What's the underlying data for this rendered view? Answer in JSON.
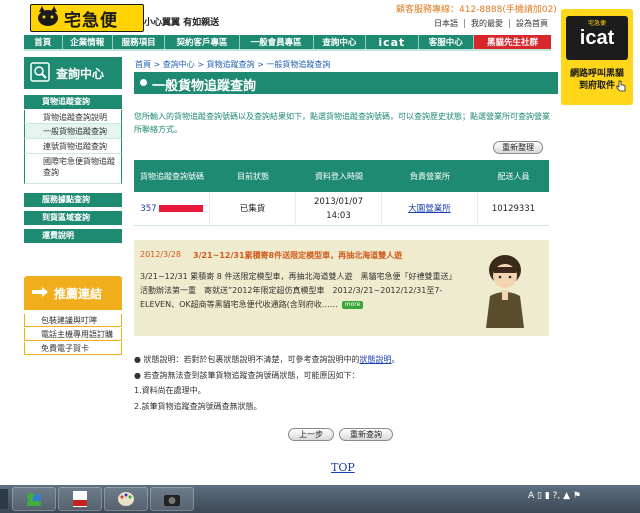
{
  "header": {
    "logo_text": "宅急便",
    "slogan": "小心翼翼 有如親送",
    "hotline": "顧客服務專線：412-8888(手機請加02)",
    "top_links": [
      "日本語",
      "我的最愛",
      "設為首頁"
    ]
  },
  "nav": {
    "items": [
      "首頁",
      "企業情報",
      "服務項目",
      "契約客戶專區",
      "一般會員專區",
      "查詢中心",
      "icat",
      "客服中心",
      "黑貓先生社群"
    ],
    "active_index": 8
  },
  "ad": {
    "small_text": "宅急便",
    "brand": "icat",
    "line1": "網路呼叫黑貓",
    "line2": "到府取件"
  },
  "sidebar": {
    "title": "查詢中心",
    "items": [
      {
        "label": "貨物追蹤查詢",
        "type": "dark"
      },
      {
        "label": "貨物追蹤查詢說明",
        "type": "light"
      },
      {
        "label": "一般貨物追蹤查詢",
        "type": "light",
        "selected": true
      },
      {
        "label": "連號貨物追蹤查詢",
        "type": "light"
      },
      {
        "label": "國際宅急便貨物追蹤查詢",
        "type": "light"
      },
      {
        "label": "服務據點查詢",
        "type": "dark"
      },
      {
        "label": "到貨區域查詢",
        "type": "dark"
      },
      {
        "label": "運費說明",
        "type": "dark"
      }
    ],
    "promo_title": "推薦連結",
    "promo_items": [
      "包裝建議與叮嚀",
      "電話主機專用語訂購",
      "免費電子賀卡"
    ]
  },
  "main": {
    "breadcrumb": "首頁 > 查詢中心 > 貨物追蹤查詢 > 一般貨物追蹤查詢",
    "title": "一般貨物追蹤查詢",
    "intro": "您所輸入的貨物追蹤查詢號碼以及查詢結果如下，點選貨物追蹤查詢號碼，可以查詢歷史狀態；點選營業所可查詢營業所聯絡方式。",
    "reset_button": "重新整理",
    "table": {
      "headers": [
        "貨物追蹤查詢號碼",
        "目前狀態",
        "資料登入時間",
        "負責營業所",
        "配送人員"
      ],
      "row": {
        "tracking_no": "357",
        "status": "已集貨",
        "date": "2013/01/07",
        "time": "14:03",
        "office": "大園營業所",
        "courier": "10129331"
      }
    },
    "news": {
      "date": "2012/3/28",
      "title": "3/21~12/31累積寄8件送限定模型車，再抽北海道雙人遊",
      "body": "3/21~12/31 累積寄 8 件送限定模型車，再抽北海道雙人遊　黑貓宅急便「好禮雙重送」活動辦法第一重　寄就送”2012年限定超仿真模型車　2012/3/21~2012/12/31至7-ELEVEN、OK超商等黑貓宅急便代收通路(含到府收……",
      "more_label": "more"
    },
    "notes": {
      "line1_prefix": "● 狀態說明：若對於包裹狀態說明不清楚，可參考查詢說明中的",
      "line1_link": "狀態說明",
      "line1_suffix": "。",
      "line2": "● 若查詢無法查到該筆貨物追蹤查詢號碼狀態，可能原因如下：",
      "line3": "1.資料尚在處理中。",
      "line4": "2.該筆貨物追蹤查詢號碼查無狀態。"
    },
    "back_button": "上一步",
    "requery_button": "重新查詢",
    "top_link": "TOP"
  },
  "taskbar": {
    "tray": "A ▯ ▮ ?, ▲ ⚑"
  },
  "colors": {
    "brand_green": "#1e8a72",
    "logo_yellow": "#ffd400",
    "promo_orange": "#f0ad1c",
    "active_red": "#d7262c"
  }
}
